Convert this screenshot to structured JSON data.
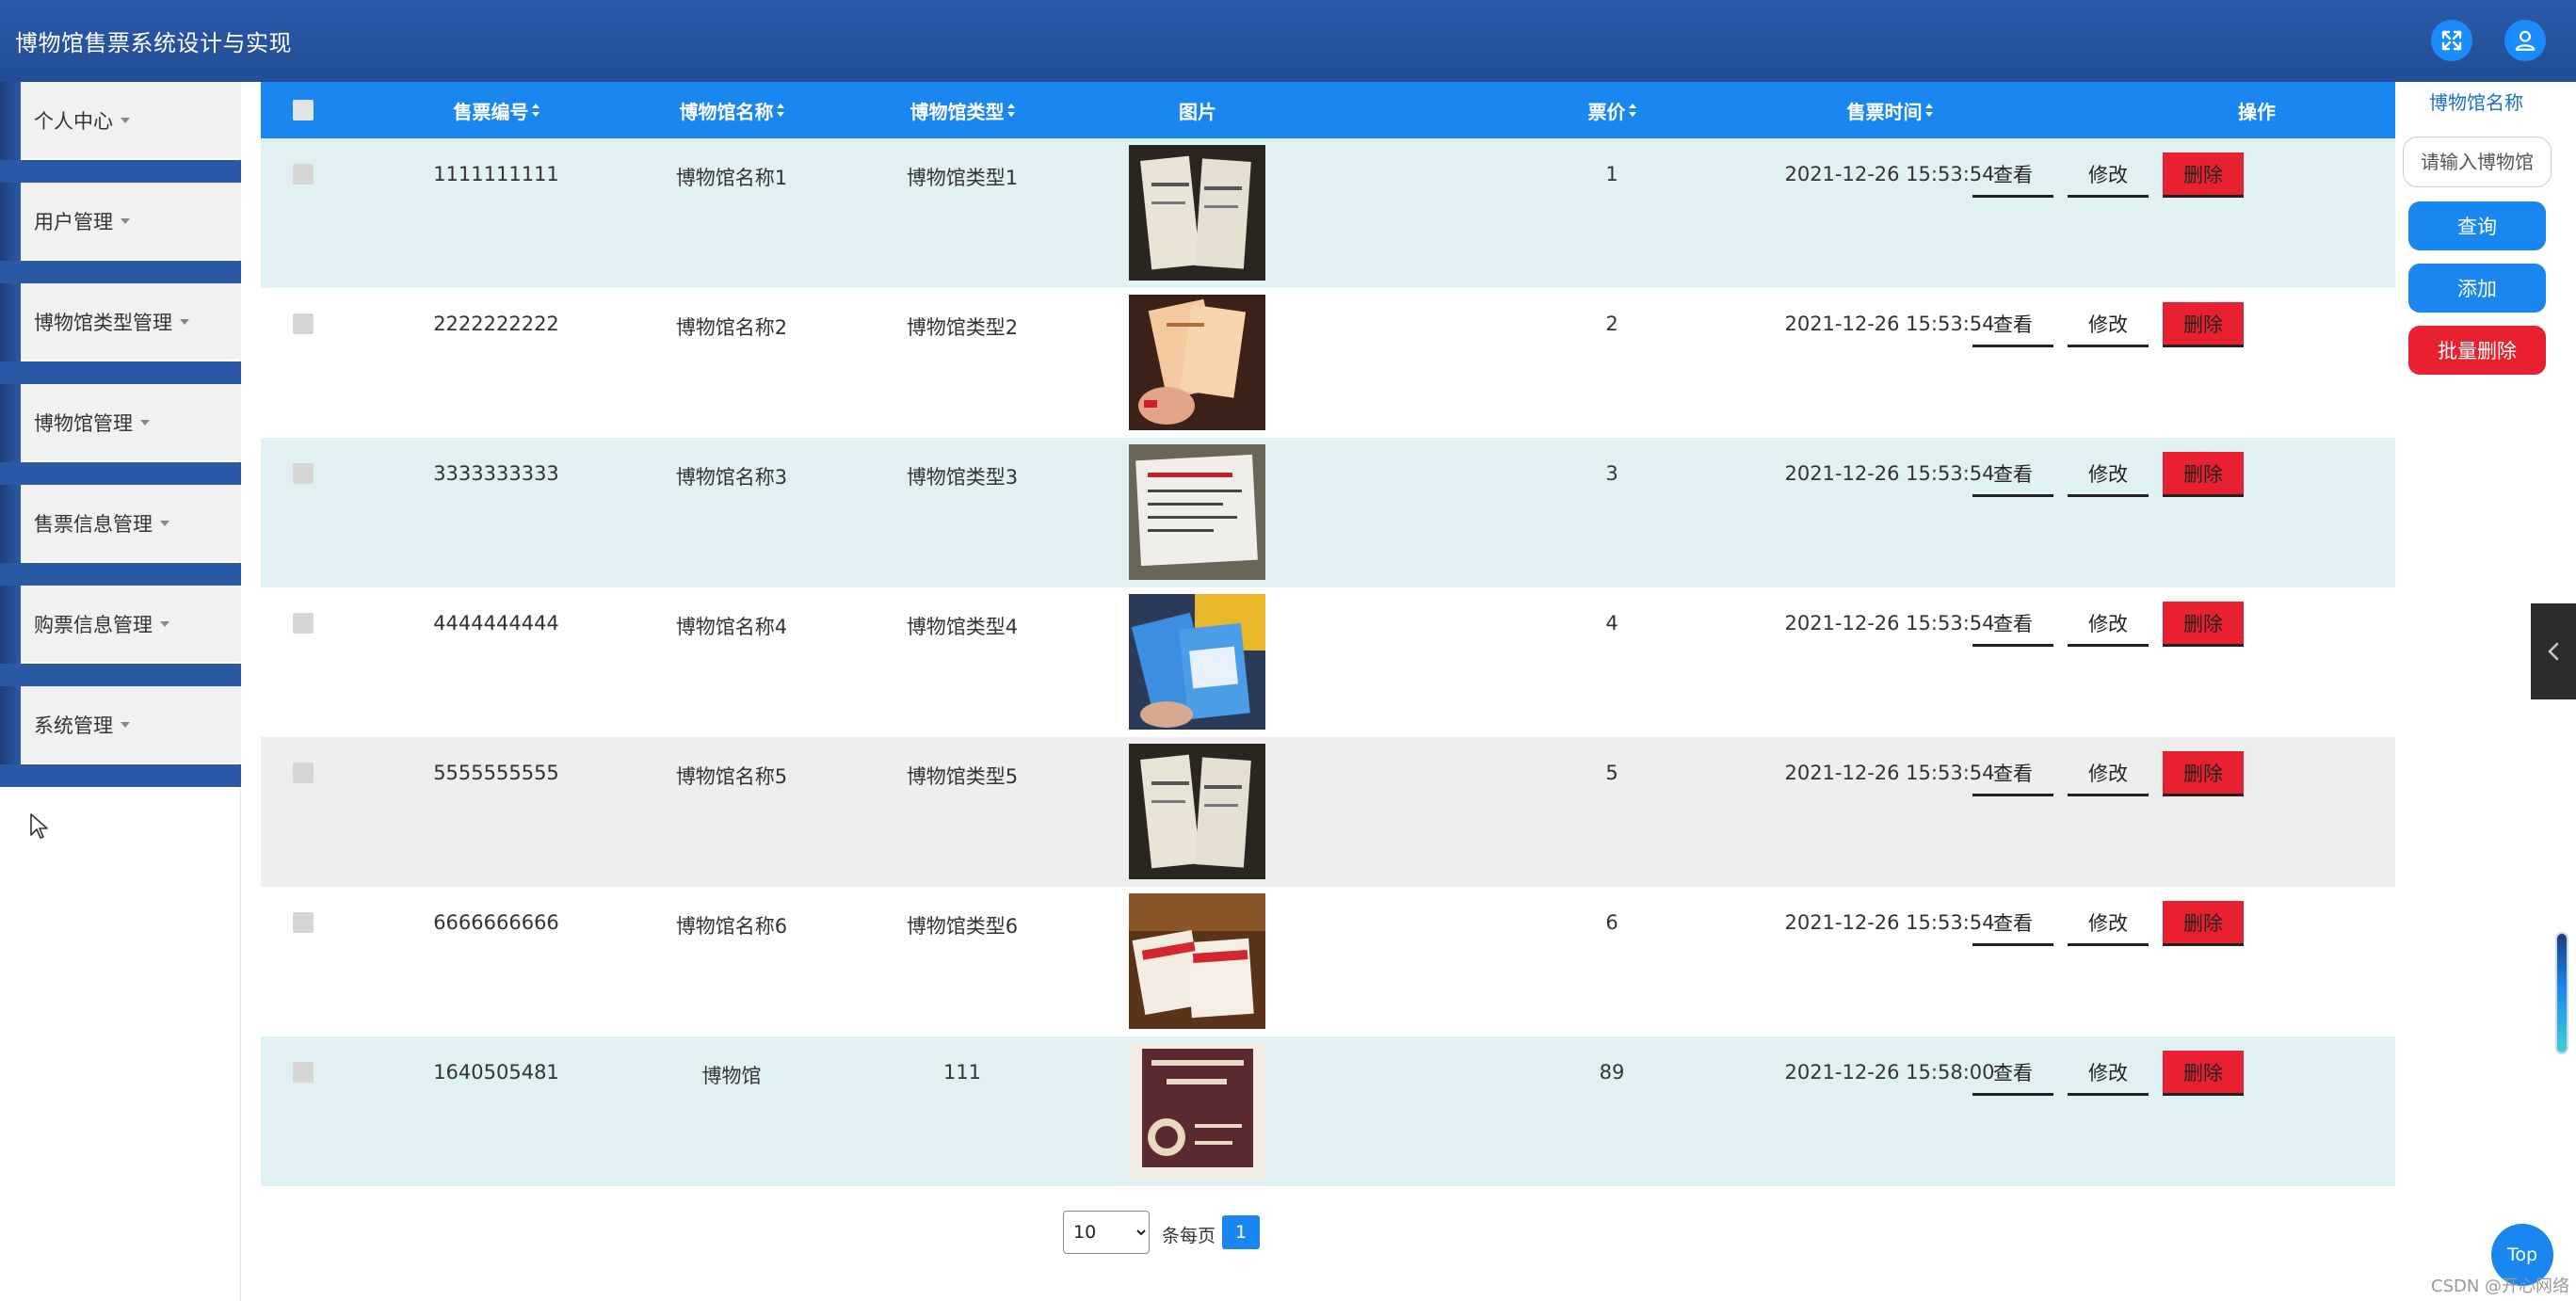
{
  "header": {
    "title": "博物馆售票系统设计与实现"
  },
  "sidebar": {
    "items": [
      {
        "label": "个人中心"
      },
      {
        "label": "用户管理"
      },
      {
        "label": "博物馆类型管理"
      },
      {
        "label": "博物馆管理"
      },
      {
        "label": "售票信息管理"
      },
      {
        "label": "购票信息管理"
      },
      {
        "label": "系统管理"
      }
    ]
  },
  "table": {
    "headers": {
      "ticket_no": "售票编号",
      "museum_name": "博物馆名称",
      "museum_type": "博物馆类型",
      "image": "图片",
      "price": "票价",
      "sale_time": "售票时间",
      "actions": "操作"
    },
    "actions": {
      "view": "查看",
      "edit": "修改",
      "delete": "删除"
    },
    "rows": [
      {
        "ticket_no": "1111111111",
        "museum_name": "博物馆名称1",
        "museum_type": "博物馆类型1",
        "price": "1",
        "sale_time": "2021-12-26 15:53:54"
      },
      {
        "ticket_no": "2222222222",
        "museum_name": "博物馆名称2",
        "museum_type": "博物馆类型2",
        "price": "2",
        "sale_time": "2021-12-26 15:53:54"
      },
      {
        "ticket_no": "3333333333",
        "museum_name": "博物馆名称3",
        "museum_type": "博物馆类型3",
        "price": "3",
        "sale_time": "2021-12-26 15:53:54"
      },
      {
        "ticket_no": "4444444444",
        "museum_name": "博物馆名称4",
        "museum_type": "博物馆类型4",
        "price": "4",
        "sale_time": "2021-12-26 15:53:54"
      },
      {
        "ticket_no": "5555555555",
        "museum_name": "博物馆名称5",
        "museum_type": "博物馆类型5",
        "price": "5",
        "sale_time": "2021-12-26 15:53:54"
      },
      {
        "ticket_no": "6666666666",
        "museum_name": "博物馆名称6",
        "museum_type": "博物馆类型6",
        "price": "6",
        "sale_time": "2021-12-26 15:53:54"
      },
      {
        "ticket_no": "1640505481",
        "museum_name": "博物馆",
        "museum_type": "111",
        "price": "89",
        "sale_time": "2021-12-26 15:58:00"
      }
    ]
  },
  "search_panel": {
    "label": "博物馆名称",
    "placeholder": "请输入博物馆",
    "query_button": "查询",
    "add_button": "添加",
    "batch_delete_button": "批量删除"
  },
  "pagination": {
    "page_size": "10",
    "page_size_label": "条每页",
    "current_page": "1"
  },
  "top_button": "Top",
  "watermark": "CSDN @开心网络",
  "colors": {
    "header": "#2a5aa8",
    "primary": "#1a86f0",
    "danger": "#e8202f",
    "row_cyan": "#dff1f2",
    "row_gray": "#eeeeee"
  }
}
